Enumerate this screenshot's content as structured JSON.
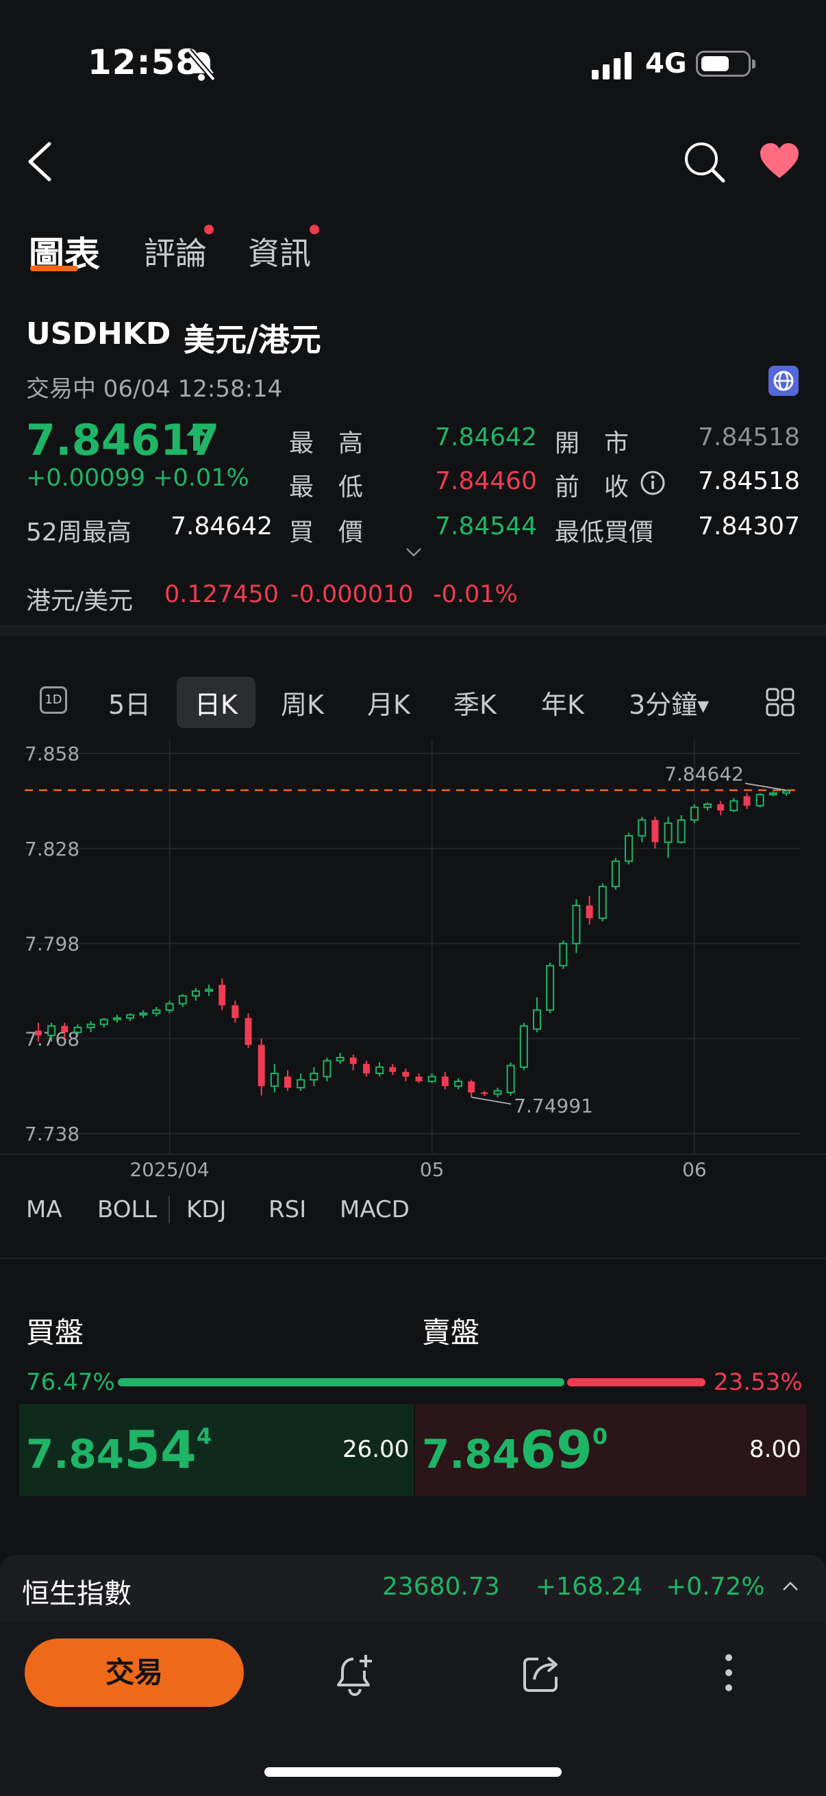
{
  "status_bar": {
    "time": "12:58",
    "network": "4G"
  },
  "tabs": [
    {
      "label": "圖表",
      "active": true,
      "dot": false
    },
    {
      "label": "評論",
      "active": false,
      "dot": true
    },
    {
      "label": "資訊",
      "active": false,
      "dot": true
    }
  ],
  "quote": {
    "symbol": "USDHKD",
    "name": "美元/港元",
    "status": "交易中 06/04 12:58:14",
    "price": "7.84617",
    "change": "+0.00099",
    "change_pct": "+0.01%",
    "week52_high_label": "52周最高",
    "week52_high": "7.84642",
    "high_label": "最　高",
    "high": "7.84642",
    "open_label": "開　市",
    "open": "7.84518",
    "low_label": "最　低",
    "low": "7.84460",
    "prev_close_label": "前　收",
    "prev_close": "7.84518",
    "bid_label": "買　價",
    "bid": "7.84544",
    "lowest_bid_label": "最低買價",
    "lowest_bid": "7.84307",
    "cross_label": "港元/美元",
    "cross_price": "0.127450",
    "cross_change": "-0.000010",
    "cross_change_pct": "-0.01%"
  },
  "periods": [
    "5日",
    "日K",
    "周K",
    "月K",
    "季K",
    "年K",
    "3分鐘"
  ],
  "active_period": "日K",
  "colors": {
    "up": "#1fb567",
    "down": "#f03c52",
    "accent": "#ee6a1a"
  },
  "chart_data": {
    "type": "candlestick",
    "yticks": [
      "7.858",
      "7.828",
      "7.798",
      "7.768",
      "7.738"
    ],
    "ytick_values": [
      7.858,
      7.828,
      7.798,
      7.768,
      7.738
    ],
    "ylim": [
      7.738,
      7.858
    ],
    "xticks": [
      "2025/04",
      "05",
      "06"
    ],
    "xtick_index": [
      10,
      30,
      50
    ],
    "high_marker": "7.84642",
    "low_marker": "7.74991",
    "reference_line": 7.8464,
    "candles": [
      {
        "o": 7.7705,
        "c": 7.769,
        "h": 7.773,
        "l": 7.767
      },
      {
        "o": 7.769,
        "c": 7.772,
        "h": 7.773,
        "l": 7.767
      },
      {
        "o": 7.772,
        "c": 7.77,
        "h": 7.773,
        "l": 7.768
      },
      {
        "o": 7.77,
        "c": 7.7715,
        "h": 7.7725,
        "l": 7.769
      },
      {
        "o": 7.7715,
        "c": 7.7725,
        "h": 7.7735,
        "l": 7.77
      },
      {
        "o": 7.7725,
        "c": 7.774,
        "h": 7.7745,
        "l": 7.7715
      },
      {
        "o": 7.774,
        "c": 7.7745,
        "h": 7.7755,
        "l": 7.773
      },
      {
        "o": 7.7745,
        "c": 7.7755,
        "h": 7.776,
        "l": 7.7735
      },
      {
        "o": 7.7755,
        "c": 7.776,
        "h": 7.777,
        "l": 7.7745
      },
      {
        "o": 7.776,
        "c": 7.777,
        "h": 7.778,
        "l": 7.775
      },
      {
        "o": 7.777,
        "c": 7.779,
        "h": 7.78,
        "l": 7.776
      },
      {
        "o": 7.779,
        "c": 7.7815,
        "h": 7.782,
        "l": 7.778
      },
      {
        "o": 7.7815,
        "c": 7.783,
        "h": 7.784,
        "l": 7.78
      },
      {
        "o": 7.783,
        "c": 7.7835,
        "h": 7.785,
        "l": 7.7815
      },
      {
        "o": 7.785,
        "c": 7.7785,
        "h": 7.787,
        "l": 7.777
      },
      {
        "o": 7.7785,
        "c": 7.7745,
        "h": 7.78,
        "l": 7.773
      },
      {
        "o": 7.7745,
        "c": 7.766,
        "h": 7.776,
        "l": 7.765
      },
      {
        "o": 7.766,
        "c": 7.753,
        "h": 7.768,
        "l": 7.75
      },
      {
        "o": 7.753,
        "c": 7.757,
        "h": 7.76,
        "l": 7.751
      },
      {
        "o": 7.756,
        "c": 7.7525,
        "h": 7.758,
        "l": 7.7515
      },
      {
        "o": 7.7525,
        "c": 7.755,
        "h": 7.757,
        "l": 7.7515
      },
      {
        "o": 7.755,
        "c": 7.757,
        "h": 7.759,
        "l": 7.753
      },
      {
        "o": 7.756,
        "c": 7.761,
        "h": 7.762,
        "l": 7.7545
      },
      {
        "o": 7.761,
        "c": 7.762,
        "h": 7.7635,
        "l": 7.76
      },
      {
        "o": 7.762,
        "c": 7.76,
        "h": 7.763,
        "l": 7.758
      },
      {
        "o": 7.76,
        "c": 7.757,
        "h": 7.761,
        "l": 7.756
      },
      {
        "o": 7.757,
        "c": 7.759,
        "h": 7.7605,
        "l": 7.756
      },
      {
        "o": 7.759,
        "c": 7.7575,
        "h": 7.76,
        "l": 7.7565
      },
      {
        "o": 7.7575,
        "c": 7.756,
        "h": 7.7585,
        "l": 7.7545
      },
      {
        "o": 7.756,
        "c": 7.7545,
        "h": 7.757,
        "l": 7.754
      },
      {
        "o": 7.7545,
        "c": 7.756,
        "h": 7.757,
        "l": 7.754
      },
      {
        "o": 7.756,
        "c": 7.753,
        "h": 7.7575,
        "l": 7.752
      },
      {
        "o": 7.753,
        "c": 7.7545,
        "h": 7.7555,
        "l": 7.752
      },
      {
        "o": 7.7545,
        "c": 7.751,
        "h": 7.755,
        "l": 7.7495
      },
      {
        "o": 7.751,
        "c": 7.7505,
        "h": 7.7515,
        "l": 7.7499
      },
      {
        "o": 7.7505,
        "c": 7.7515,
        "h": 7.7525,
        "l": 7.7495
      },
      {
        "o": 7.751,
        "c": 7.7595,
        "h": 7.7605,
        "l": 7.75
      },
      {
        "o": 7.759,
        "c": 7.772,
        "h": 7.773,
        "l": 7.758
      },
      {
        "o": 7.771,
        "c": 7.777,
        "h": 7.781,
        "l": 7.77
      },
      {
        "o": 7.777,
        "c": 7.791,
        "h": 7.792,
        "l": 7.776
      },
      {
        "o": 7.791,
        "c": 7.798,
        "h": 7.799,
        "l": 7.79
      },
      {
        "o": 7.798,
        "c": 7.81,
        "h": 7.812,
        "l": 7.795
      },
      {
        "o": 7.81,
        "c": 7.806,
        "h": 7.813,
        "l": 7.804
      },
      {
        "o": 7.806,
        "c": 7.816,
        "h": 7.817,
        "l": 7.805
      },
      {
        "o": 7.816,
        "c": 7.824,
        "h": 7.825,
        "l": 7.815
      },
      {
        "o": 7.824,
        "c": 7.832,
        "h": 7.833,
        "l": 7.823
      },
      {
        "o": 7.832,
        "c": 7.837,
        "h": 7.838,
        "l": 7.83
      },
      {
        "o": 7.837,
        "c": 7.83,
        "h": 7.838,
        "l": 7.828
      },
      {
        "o": 7.83,
        "c": 7.836,
        "h": 7.838,
        "l": 7.825
      },
      {
        "o": 7.83,
        "c": 7.837,
        "h": 7.8385,
        "l": 7.8295
      },
      {
        "o": 7.837,
        "c": 7.841,
        "h": 7.842,
        "l": 7.836
      },
      {
        "o": 7.841,
        "c": 7.842,
        "h": 7.8425,
        "l": 7.84
      },
      {
        "o": 7.842,
        "c": 7.84,
        "h": 7.843,
        "l": 7.8385
      },
      {
        "o": 7.84,
        "c": 7.843,
        "h": 7.844,
        "l": 7.8395
      },
      {
        "o": 7.8445,
        "c": 7.8415,
        "h": 7.8455,
        "l": 7.8405
      },
      {
        "o": 7.8415,
        "c": 7.845,
        "h": 7.8455,
        "l": 7.841
      },
      {
        "o": 7.845,
        "c": 7.8455,
        "h": 7.846,
        "l": 7.8445
      },
      {
        "o": 7.8455,
        "c": 7.8462,
        "h": 7.8464,
        "l": 7.8446
      }
    ]
  },
  "indicators": [
    "MA",
    "BOLL",
    "KDJ",
    "RSI",
    "MACD"
  ],
  "order_book": {
    "bid_title": "買盤",
    "ask_title": "賣盤",
    "bid_pct": "76.47%",
    "ask_pct": "23.53%",
    "bid_ratio": 0.7647,
    "bid_price_head": "7.84",
    "bid_price_big": "54",
    "bid_price_tail": "4",
    "bid_qty": "26.00",
    "ask_price_head": "7.84",
    "ask_price_big": "69",
    "ask_price_tail": "0",
    "ask_qty": "8.00"
  },
  "index_bar": {
    "name": "恒生指數",
    "value": "23680.73",
    "change": "+168.24",
    "change_pct": "+0.72%"
  },
  "bottom": {
    "trade_label": "交易"
  }
}
